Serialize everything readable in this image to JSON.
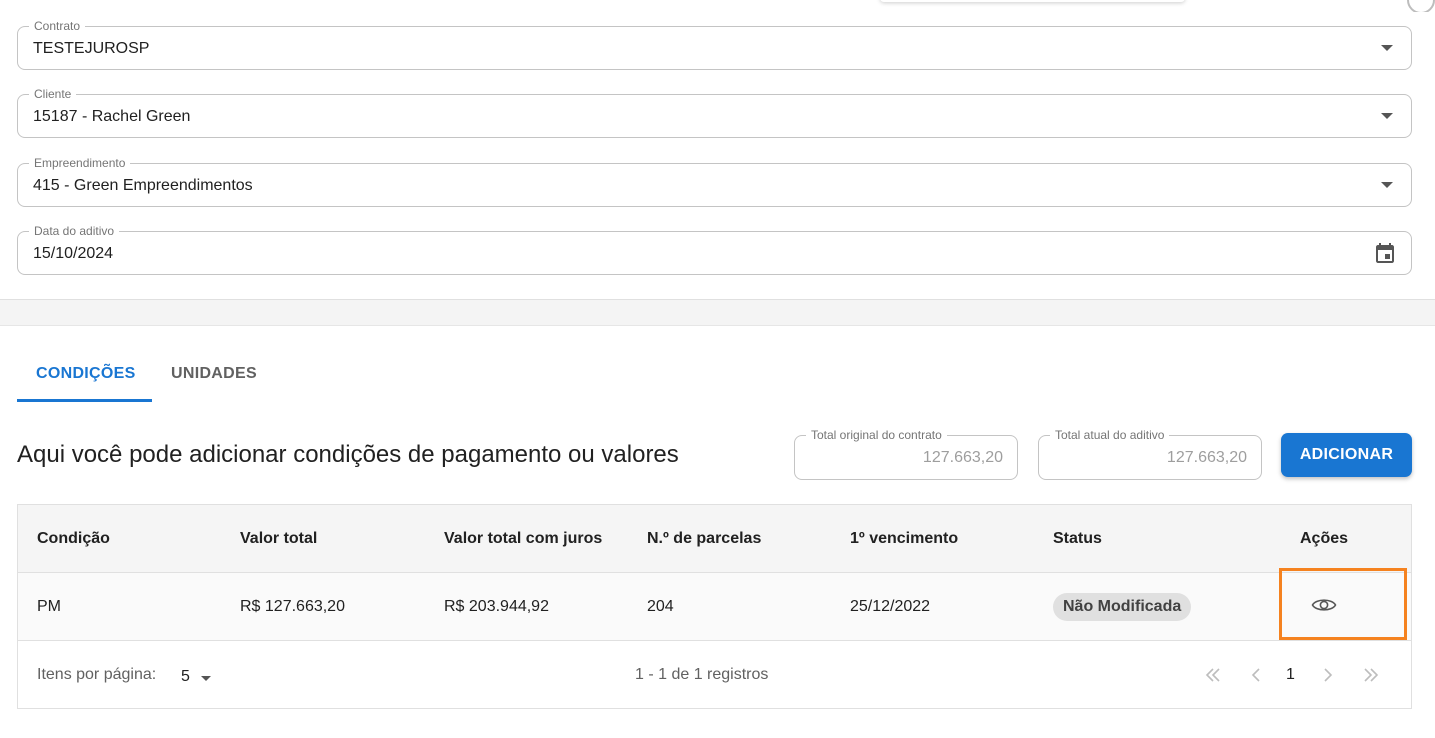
{
  "form": {
    "contrato": {
      "label": "Contrato",
      "value": "TESTEJUROSP"
    },
    "cliente": {
      "label": "Cliente",
      "value": "15187 - Rachel Green"
    },
    "empreendimento": {
      "label": "Empreendimento",
      "value": "415 - Green Empreendimentos"
    },
    "data_aditivo": {
      "label": "Data do aditivo",
      "value": "15/10/2024"
    }
  },
  "tabs": [
    {
      "label": "CONDIÇÕES",
      "active": true
    },
    {
      "label": "UNIDADES",
      "active": false
    }
  ],
  "intro_text": "Aqui você pode adicionar condições de pagamento ou valores",
  "totals": {
    "original": {
      "label": "Total original do contrato",
      "value": "127.663,20"
    },
    "atual": {
      "label": "Total atual do aditivo",
      "value": "127.663,20"
    }
  },
  "add_button_label": "ADICIONAR",
  "table": {
    "columns": [
      "Condição",
      "Valor total",
      "Valor total com juros",
      "N.º de parcelas",
      "1º vencimento",
      "Status",
      "Ações"
    ],
    "rows": [
      {
        "condicao": "PM",
        "valor_total": "R$ 127.663,20",
        "valor_total_juros": "R$ 203.944,92",
        "parcelas": "204",
        "vencimento": "25/12/2022",
        "status": "Não Modificada",
        "action_icon": "eye-icon"
      }
    ]
  },
  "pagination": {
    "per_page_label": "Itens por página:",
    "per_page_value": "5",
    "records_text": "1 - 1 de 1 registros",
    "current_page": "1"
  },
  "colors": {
    "primary": "#1976d2",
    "highlight": "#f5821f",
    "badge_bg": "#e0e0e0"
  }
}
